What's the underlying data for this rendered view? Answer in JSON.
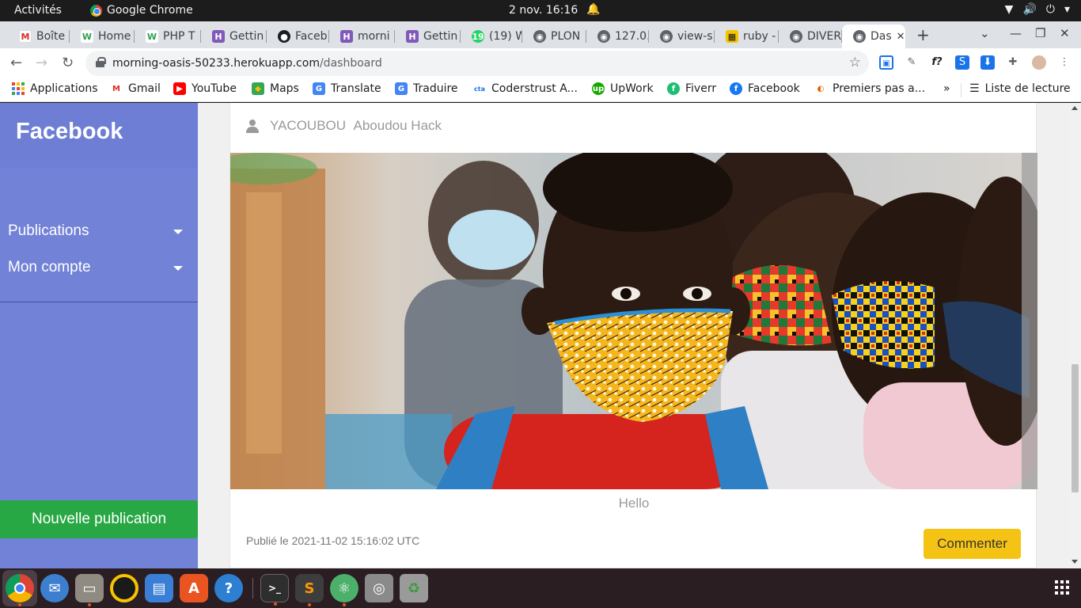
{
  "topbar": {
    "activities": "Activités",
    "app_name": "Google Chrome",
    "clock": "2 nov.  16:16"
  },
  "tabs": [
    {
      "label": "Boîte",
      "icon": "gmail-icon"
    },
    {
      "label": "Home",
      "icon": "w-icon"
    },
    {
      "label": "PHP T",
      "icon": "w-icon"
    },
    {
      "label": "Gettin",
      "icon": "heroku-icon"
    },
    {
      "label": "Faceb",
      "icon": "github-icon"
    },
    {
      "label": "morni",
      "icon": "heroku-icon"
    },
    {
      "label": "Gettin",
      "icon": "heroku-icon"
    },
    {
      "label": "(19) W",
      "icon": "whatsapp-icon"
    },
    {
      "label": "PLON",
      "icon": "globe-icon"
    },
    {
      "label": "127.0.",
      "icon": "globe-icon"
    },
    {
      "label": "view-s",
      "icon": "globe-icon"
    },
    {
      "label": "ruby -",
      "icon": "ruby-icon"
    },
    {
      "label": "DIVER",
      "icon": "globe-icon"
    },
    {
      "label": "Das",
      "icon": "globe-icon",
      "active": true
    }
  ],
  "toolbar": {
    "url_host": "morning-oasis-50233.herokuapp.com",
    "url_path": "/dashboard"
  },
  "bookmarks": [
    {
      "label": "Applications",
      "icon": "apps-grid-icon"
    },
    {
      "label": "Gmail",
      "icon": "gmail-icon"
    },
    {
      "label": "YouTube",
      "icon": "youtube-icon"
    },
    {
      "label": "Maps",
      "icon": "maps-icon"
    },
    {
      "label": "Translate",
      "icon": "translate-icon"
    },
    {
      "label": "Traduire",
      "icon": "translate-icon"
    },
    {
      "label": "Coderstrust A...",
      "icon": "cta-icon"
    },
    {
      "label": "UpWork",
      "icon": "upwork-icon"
    },
    {
      "label": "Fiverr",
      "icon": "fiverr-icon"
    },
    {
      "label": "Facebook",
      "icon": "facebook-icon"
    },
    {
      "label": "Premiers pas a...",
      "icon": "firefox-icon"
    }
  ],
  "bookmarks_more": "»",
  "reading_list": "Liste de lecture",
  "sidebar": {
    "brand": "Facebook",
    "menu": [
      {
        "label": "Publications"
      },
      {
        "label": "Mon compte"
      }
    ],
    "new_post": "Nouvelle publication"
  },
  "post": {
    "author_first": "YACOUBOU",
    "author_last": "Aboudou Hack",
    "caption": "Hello",
    "published": "Publié le 2021-11-02 15:16:02 UTC",
    "comment_button": "Commenter"
  },
  "colors": {
    "sidebar": "#7282d7",
    "new_post": "#28a745",
    "comment": "#f5c313"
  }
}
